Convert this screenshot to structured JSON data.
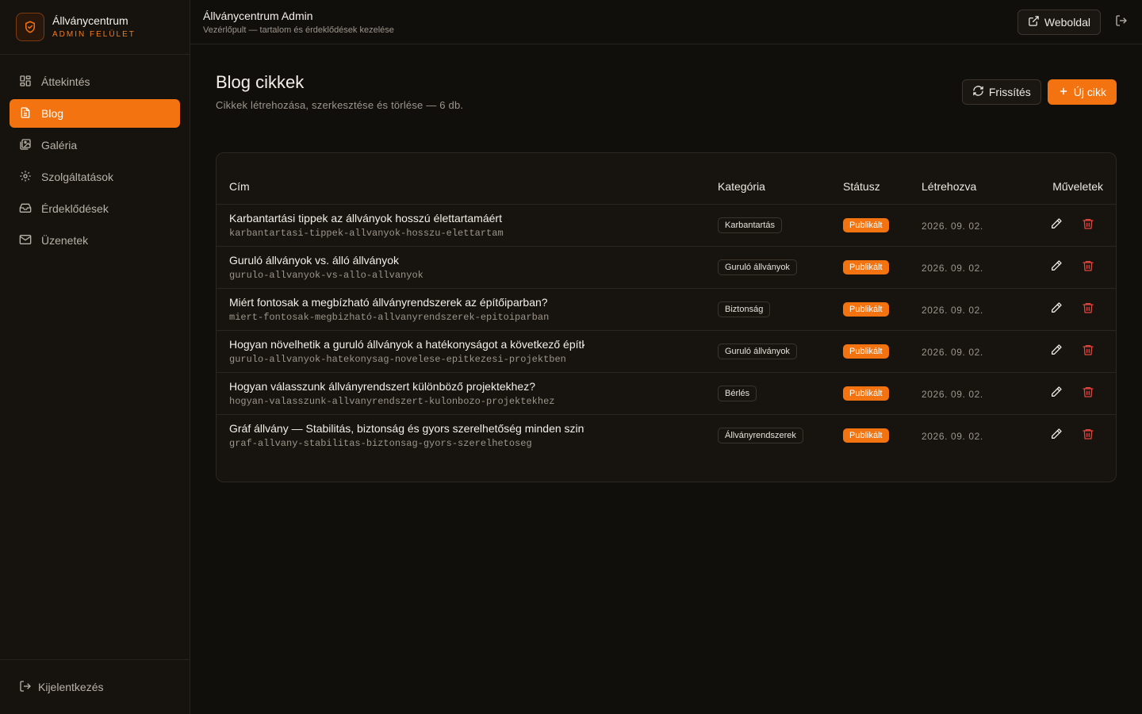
{
  "brand": {
    "title": "Állványcentrum",
    "subtitle": "ADMIN FELÜLET"
  },
  "sidebar": {
    "items": [
      {
        "label": "Áttekintés",
        "icon": "dashboard-icon"
      },
      {
        "label": "Blog",
        "icon": "document-icon",
        "active": true
      },
      {
        "label": "Galéria",
        "icon": "gallery-icon"
      },
      {
        "label": "Szolgáltatások",
        "icon": "gear-icon"
      },
      {
        "label": "Érdeklődések",
        "icon": "inbox-icon"
      },
      {
        "label": "Üzenetek",
        "icon": "mail-icon"
      }
    ],
    "logout_label": "Kijelentkezés"
  },
  "topbar": {
    "title": "Állványcentrum Admin",
    "subtitle": "Vezérlőpult — tartalom és érdeklődések kezelése",
    "website_label": "Weboldal"
  },
  "page": {
    "title": "Blog cikkek",
    "subtitle": "Cikkek létrehozása, szerkesztése és törlése — 6 db.",
    "refresh_label": "Frissítés",
    "new_label": "Új cikk"
  },
  "table": {
    "headers": {
      "title": "Cím",
      "category": "Kategória",
      "status": "Státusz",
      "created": "Létrehozva",
      "actions": "Műveletek"
    },
    "rows": [
      {
        "title": "Karbantartási tippek az állványok hosszú élettartamáért",
        "slug": "karbantartasi-tippek-allvanyok-hosszu-elettartam",
        "category": "Karbantartás",
        "status": "Publikált",
        "date": "2026. 09. 02."
      },
      {
        "title": "Guruló állványok vs. álló állványok",
        "slug": "gurulo-allvanyok-vs-allo-allvanyok",
        "category": "Guruló állványok",
        "status": "Publikált",
        "date": "2026. 09. 02."
      },
      {
        "title": "Miért fontosak a megbízható állványrendszerek az építőiparban?",
        "slug": "miert-fontosak-megbizható-allvanyrendszerek-epitoiparban",
        "category": "Biztonság",
        "status": "Publikált",
        "date": "2026. 09. 02."
      },
      {
        "title": "Hogyan növelhetik a guruló állványok a hatékonyságot a következő építke",
        "slug": "gurulo-allvanyok-hatekonysag-novelese-epitkezesi-projektben",
        "category": "Guruló állványok",
        "status": "Publikált",
        "date": "2026. 09. 02."
      },
      {
        "title": "Hogyan válasszunk állványrendszert különböző projektekhez?",
        "slug": "hogyan-valasszunk-allvanyrendszert-kulonbozo-projektekhez",
        "category": "Bérlés",
        "status": "Publikált",
        "date": "2026. 09. 02."
      },
      {
        "title": "Gráf állvány — Stabilitás, biztonság és gyors szerelhetőség minden szinte",
        "slug": "graf-allvany-stabilitas-biztonsag-gyors-szerelhetoseg",
        "category": "Állványrendszerek",
        "status": "Publikált",
        "date": "2026. 09. 02."
      }
    ]
  },
  "colors": {
    "accent": "#f2730f",
    "danger": "#e2443f",
    "background": "#110f0c"
  }
}
